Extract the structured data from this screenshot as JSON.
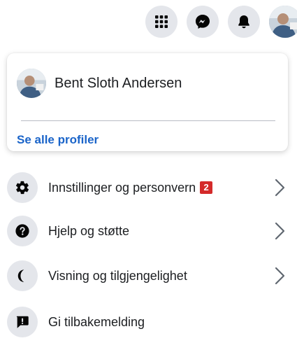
{
  "topbar": {
    "menu_icon": "grid-menu-icon",
    "messenger_icon": "messenger-icon",
    "notifications_icon": "bell-icon",
    "account_icon": "profile-photo"
  },
  "profile_card": {
    "name": "Bent Sloth Andersen",
    "see_all_label": "Se alle profiler"
  },
  "menu": {
    "items": [
      {
        "label": "Innstillinger og personvern",
        "icon": "gear-icon",
        "badge": "2",
        "has_chevron": true
      },
      {
        "label": "Hjelp og støtte",
        "icon": "question-icon",
        "has_chevron": true
      },
      {
        "label": "Visning og tilgjengelighet",
        "icon": "moon-icon",
        "has_chevron": true
      },
      {
        "label": "Gi tilbakemelding",
        "icon": "feedback-icon",
        "has_chevron": false
      }
    ]
  },
  "colors": {
    "accent_link": "#1a64c9",
    "badge_red": "#d42a2a",
    "icon_circle": "#e4e6eb"
  }
}
